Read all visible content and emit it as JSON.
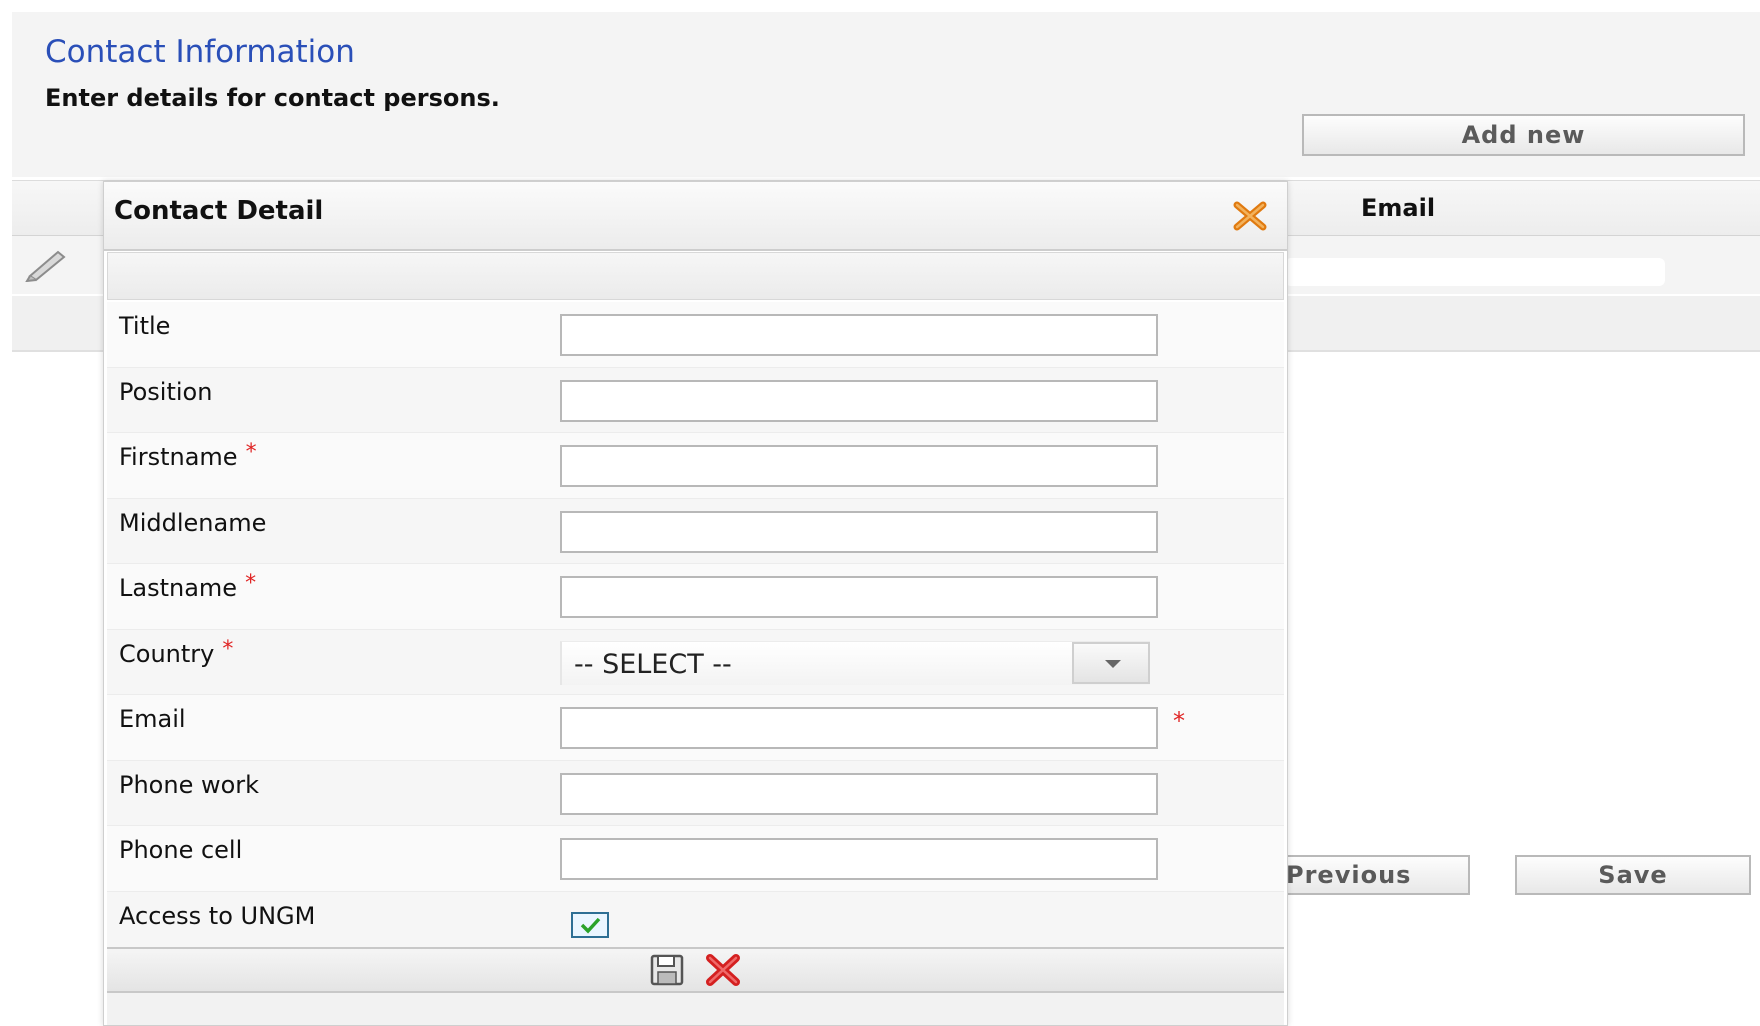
{
  "page": {
    "title": "Contact Information",
    "subtitle": "Enter details for contact persons.",
    "add_new_label": "Add new",
    "grid_email_header": "Email",
    "previous_label": "Previous",
    "save_label": "Save"
  },
  "dialog": {
    "title": "Contact Detail",
    "fields": [
      {
        "label": "Title",
        "required": false
      },
      {
        "label": "Position",
        "required": false
      },
      {
        "label": "Firstname",
        "required": true
      },
      {
        "label": "Middlename",
        "required": false
      },
      {
        "label": "Lastname",
        "required": true
      },
      {
        "label": "Country",
        "required": true
      },
      {
        "label": "Email",
        "required": true
      },
      {
        "label": "Phone work",
        "required": false
      },
      {
        "label": "Phone cell",
        "required": false
      },
      {
        "label": "Access to UNGM",
        "required": false
      }
    ],
    "country_selected": "-- SELECT --",
    "required_mark": "*",
    "access_checked": true
  },
  "colors": {
    "title_blue": "#2a4fb8",
    "required_red": "#e02424",
    "close_orange": "#e07a10",
    "checkbox_border": "#2d6f94",
    "check_green": "#2aa32a"
  },
  "icons": [
    "pencil-icon",
    "close-icon",
    "save-icon",
    "cancel-icon",
    "chevron-down-icon",
    "check-icon"
  ]
}
